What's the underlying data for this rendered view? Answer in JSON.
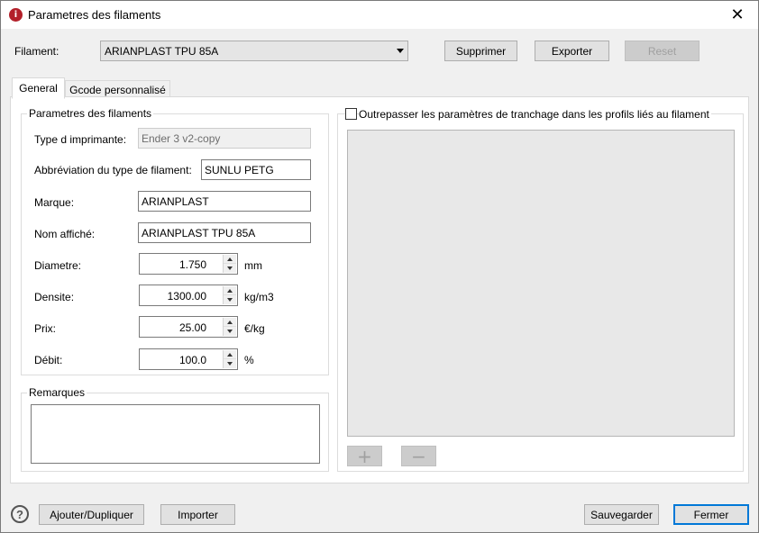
{
  "window": {
    "title": "Parametres des filaments",
    "close_glyph": "✕",
    "app_icon_glyph": "i"
  },
  "top": {
    "filament_label": "Filament:",
    "filament_selected": "ARIANPLAST TPU 85A",
    "delete_label": "Supprimer",
    "export_label": "Exporter",
    "reset_label": "Reset"
  },
  "tabs": [
    {
      "label": "General",
      "active": true
    },
    {
      "label": "Gcode personnalisé",
      "active": false
    }
  ],
  "filament_group": {
    "title": "Parametres des filaments",
    "printer_type_label": "Type d imprimante:",
    "printer_type_value": "Ender 3 v2-copy",
    "type_abbrev_label": "Abbréviation du type de filament:",
    "type_abbrev_value": "SUNLU PETG",
    "brand_label": "Marque:",
    "brand_value": "ARIANPLAST",
    "display_name_label": "Nom affiché:",
    "display_name_value": "ARIANPLAST TPU 85A",
    "diameter_label": "Diametre:",
    "diameter_value": "1.750",
    "diameter_unit": "mm",
    "density_label": "Densite:",
    "density_value": "1300.00",
    "density_unit": "kg/m3",
    "price_label": "Prix:",
    "price_value": "25.00",
    "price_unit": "€/kg",
    "flow_label": "Débit:",
    "flow_value": "100.0",
    "flow_unit": "%"
  },
  "remarks": {
    "title": "Remarques",
    "value": ""
  },
  "override": {
    "checkbox_label": "Outrepasser les paramètres de tranchage dans les profils liés au filament",
    "checked": false,
    "add_glyph": "+",
    "remove_glyph": "−"
  },
  "bottom": {
    "help_glyph": "?",
    "add_duplicate_label": "Ajouter/Dupliquer",
    "import_label": "Importer",
    "save_label": "Sauvegarder",
    "close_label": "Fermer"
  }
}
